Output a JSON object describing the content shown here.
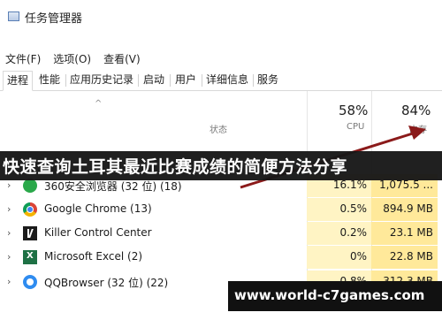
{
  "window": {
    "title": "任务管理器"
  },
  "menu": [
    "文件(F)",
    "选项(O)",
    "查看(V)"
  ],
  "tabs": [
    "进程",
    "性能",
    "应用历史记录",
    "启动",
    "用户",
    "详细信息",
    "服务"
  ],
  "columns": {
    "status_label": "状态",
    "cpu_pct": "58%",
    "cpu_label": "CPU",
    "mem_pct": "84%",
    "mem_label": "内存"
  },
  "rows": [
    {
      "name": "360安全浏览器 (32 位) (18)",
      "cpu": "16.1%",
      "mem": "1,075.5 ..."
    },
    {
      "name": "Google Chrome (13)",
      "cpu": "0.5%",
      "mem": "894.9 MB"
    },
    {
      "name": "Killer Control Center",
      "cpu": "0.2%",
      "mem": "23.1 MB"
    },
    {
      "name": "Microsoft Excel (2)",
      "cpu": "0%",
      "mem": "22.8 MB"
    },
    {
      "name": "QQBrowser (32 位) (22)",
      "cpu": "0.8%",
      "mem": "312.3 MB"
    }
  ],
  "overlay": {
    "headline": "快速查询土耳其最近比赛成绩的简便方法分享",
    "url": "www.world-c7games.com"
  },
  "colors": {
    "arrow": "#8b1a1a",
    "cpu_heat": "#fff4c4",
    "mem_heat": "#ffe99a"
  }
}
